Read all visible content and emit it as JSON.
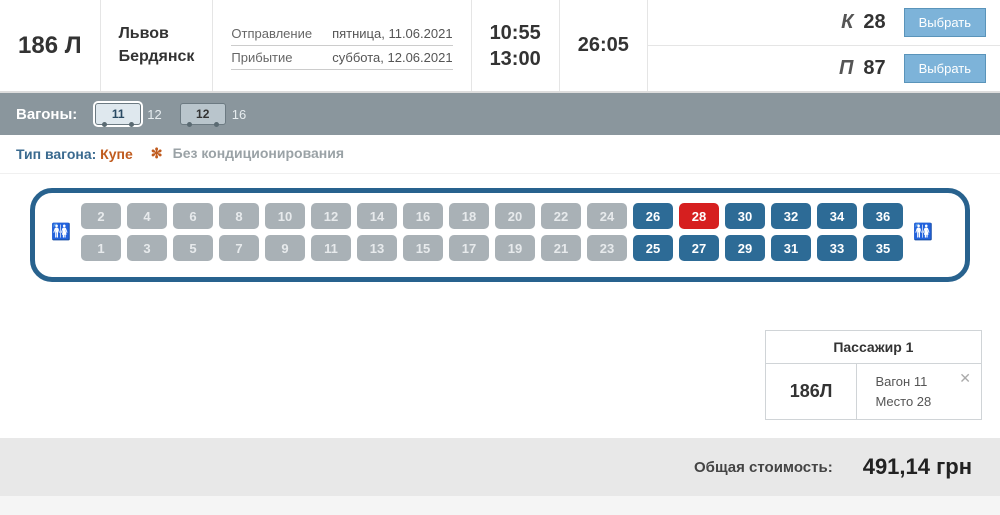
{
  "header": {
    "train_number": "186 Л",
    "from": "Львов",
    "to": "Бердянск",
    "departure_label": "Отправление",
    "departure_value": "пятница, 11.06.2021",
    "arrival_label": "Прибытие",
    "arrival_value": "суббота, 12.06.2021",
    "dep_time": "10:55",
    "arr_time": "13:00",
    "duration": "26:05",
    "classes": [
      {
        "code": "К",
        "count": "28",
        "btn": "Выбрать"
      },
      {
        "code": "П",
        "count": "87",
        "btn": "Выбрать"
      }
    ]
  },
  "wagons": {
    "label": "Вагоны:",
    "items": [
      {
        "num": "11",
        "cap": "12",
        "selected": true
      },
      {
        "num": "12",
        "cap": "16",
        "selected": false
      }
    ]
  },
  "car_type": {
    "label": "Тип вагона:",
    "value": "Купе",
    "ac_text": "Без кондиционирования"
  },
  "seatmap": {
    "bays": [
      {
        "top": {
          "n": "2",
          "s": "taken"
        },
        "bot": {
          "n": "1",
          "s": "taken"
        }
      },
      {
        "top": {
          "n": "4",
          "s": "taken"
        },
        "bot": {
          "n": "3",
          "s": "taken"
        }
      },
      {
        "top": {
          "n": "6",
          "s": "taken"
        },
        "bot": {
          "n": "5",
          "s": "taken"
        }
      },
      {
        "top": {
          "n": "8",
          "s": "taken"
        },
        "bot": {
          "n": "7",
          "s": "taken"
        }
      },
      {
        "top": {
          "n": "10",
          "s": "taken"
        },
        "bot": {
          "n": "9",
          "s": "taken"
        }
      },
      {
        "top": {
          "n": "12",
          "s": "taken"
        },
        "bot": {
          "n": "11",
          "s": "taken"
        }
      },
      {
        "top": {
          "n": "14",
          "s": "taken"
        },
        "bot": {
          "n": "13",
          "s": "taken"
        }
      },
      {
        "top": {
          "n": "16",
          "s": "taken"
        },
        "bot": {
          "n": "15",
          "s": "taken"
        }
      },
      {
        "top": {
          "n": "18",
          "s": "taken"
        },
        "bot": {
          "n": "17",
          "s": "taken"
        }
      },
      {
        "top": {
          "n": "20",
          "s": "taken"
        },
        "bot": {
          "n": "19",
          "s": "taken"
        }
      },
      {
        "top": {
          "n": "22",
          "s": "taken"
        },
        "bot": {
          "n": "21",
          "s": "taken"
        }
      },
      {
        "top": {
          "n": "24",
          "s": "taken"
        },
        "bot": {
          "n": "23",
          "s": "taken"
        }
      },
      {
        "top": {
          "n": "26",
          "s": "free"
        },
        "bot": {
          "n": "25",
          "s": "free"
        }
      },
      {
        "top": {
          "n": "28",
          "s": "selected"
        },
        "bot": {
          "n": "27",
          "s": "free"
        }
      },
      {
        "top": {
          "n": "30",
          "s": "free"
        },
        "bot": {
          "n": "29",
          "s": "free"
        }
      },
      {
        "top": {
          "n": "32",
          "s": "free"
        },
        "bot": {
          "n": "31",
          "s": "free"
        }
      },
      {
        "top": {
          "n": "34",
          "s": "free"
        },
        "bot": {
          "n": "33",
          "s": "free"
        }
      },
      {
        "top": {
          "n": "36",
          "s": "free"
        },
        "bot": {
          "n": "35",
          "s": "free"
        }
      }
    ]
  },
  "passenger": {
    "title": "Пассажир 1",
    "train": "186Л",
    "wagon_line": "Вагон 11",
    "seat_line": "Место 28"
  },
  "total": {
    "label": "Общая стоимость:",
    "value": "491,14 грн"
  }
}
